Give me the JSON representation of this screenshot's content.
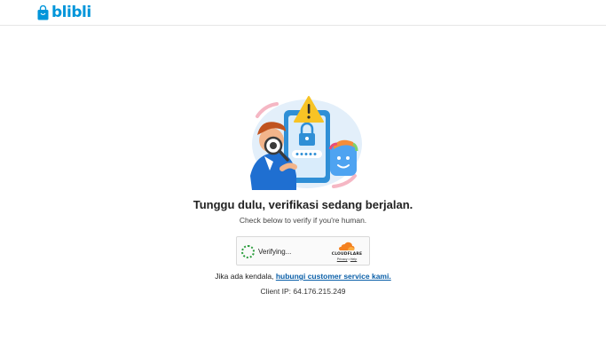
{
  "brand": {
    "name": "blibli",
    "color": "#0095da"
  },
  "main": {
    "title": "Tunggu dulu, verifikasi sedang berjalan.",
    "subtitle": "Check below to verify if you're human."
  },
  "widget": {
    "status": "Verifying...",
    "provider": "CLOUDFLARE",
    "privacy_link": "Privacy",
    "separator": "•",
    "help_link": "Help"
  },
  "help": {
    "prefix": "Jika ada kendala,",
    "link": "hubungi customer service kami."
  },
  "footer": {
    "client_ip": "Client IP: 64.176.215.249"
  },
  "colors": {
    "accent_blue": "#0095da",
    "link_blue": "#0a5fa8",
    "warning_yellow": "#f7c325",
    "spinner_green": "#2a9d3c",
    "cloudflare_orange": "#f48120"
  }
}
